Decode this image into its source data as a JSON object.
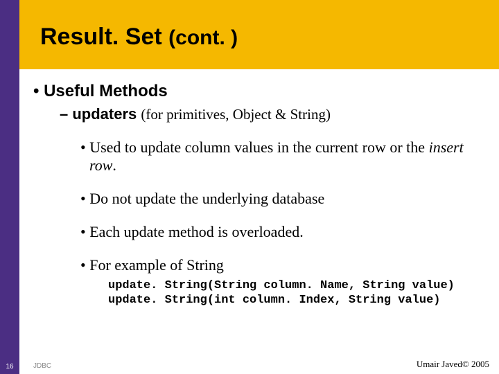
{
  "title": {
    "main": "Result. Set",
    "suffix": "(cont. )"
  },
  "content": {
    "heading": "Useful Methods",
    "sub": {
      "prefix": "– ",
      "label": "updaters",
      "qualifier": "(for primitives, Object & String)"
    },
    "points": [
      "Used to update column values in the current row or the ",
      "Do not update the underlying database",
      "Each update method is overloaded.",
      "For example of String"
    ],
    "insert_row": "insert row",
    "point1_tail": ".",
    "code_lines": [
      "update. String(String column. Name, String value)",
      "update. String(int column. Index, String value)"
    ]
  },
  "footer": {
    "page": "16",
    "topic": "JDBC",
    "credit": "Umair Javed© 2005"
  }
}
